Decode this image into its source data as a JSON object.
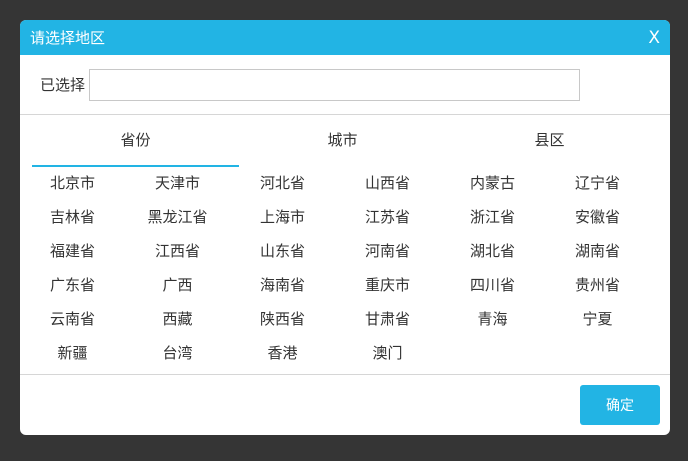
{
  "dialog": {
    "title": "请选择地区",
    "close_label": "X",
    "selected_label": "已选择",
    "selected_value": "",
    "confirm_label": "确定"
  },
  "tabs": [
    {
      "label": "省份"
    },
    {
      "label": "城市"
    },
    {
      "label": "县区"
    }
  ],
  "provinces": [
    "北京市",
    "天津市",
    "河北省",
    "山西省",
    "内蒙古",
    "辽宁省",
    "吉林省",
    "黑龙江省",
    "上海市",
    "江苏省",
    "浙江省",
    "安徽省",
    "福建省",
    "江西省",
    "山东省",
    "河南省",
    "湖北省",
    "湖南省",
    "广东省",
    "广西",
    "海南省",
    "重庆市",
    "四川省",
    "贵州省",
    "云南省",
    "西藏",
    "陕西省",
    "甘肃省",
    "青海",
    "宁夏",
    "新疆",
    "台湾",
    "香港",
    "澳门"
  ],
  "colors": {
    "accent": "#22b4e4",
    "backdrop": "#353535"
  }
}
